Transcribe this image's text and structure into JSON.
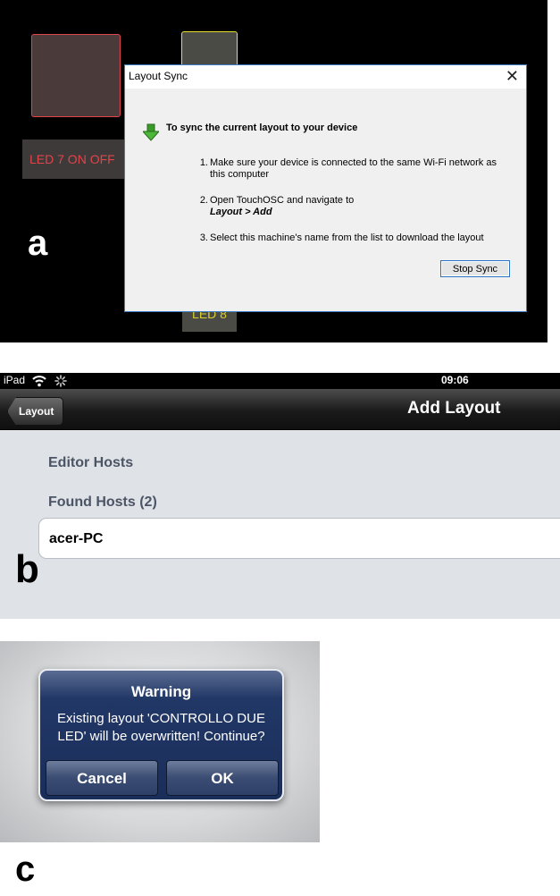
{
  "panel_a": {
    "letter": "a",
    "led_label": "LED 7 ON OFF",
    "led_bottom_label": "LED 8",
    "dialog": {
      "title": "Layout Sync",
      "close_glyph": "✕",
      "heading": "To sync the current layout to your device",
      "steps": [
        {
          "num": "1.",
          "text_line1": "Make sure your device is connected to the same Wi-Fi network as",
          "text_line2": "this computer"
        },
        {
          "num": "2.",
          "text_line1": "Open TouchOSC and navigate to",
          "text_line2": "Layout > Add"
        },
        {
          "num": "3.",
          "text_line1": "Select this machine's name from the list to download the layout"
        }
      ],
      "stop_button": "Stop Sync",
      "icon": "green-down-arrow-icon"
    },
    "colors": {
      "red_led": "#e0454a",
      "yellow_led": "#e8e030"
    }
  },
  "panel_b": {
    "letter": "b",
    "status": {
      "carrier": "iPad",
      "time": "09:06"
    },
    "nav": {
      "back_label": "Layout",
      "title": "Add Layout"
    },
    "sections": {
      "editor_hosts": "Editor Hosts",
      "found_hosts": "Found Hosts (2)"
    },
    "hosts": [
      {
        "name": "acer-PC"
      }
    ]
  },
  "panel_c": {
    "letter": "c",
    "alert": {
      "title": "Warning",
      "message_line1": "Existing layout 'CONTROLLO DUE",
      "message_line2": "LED' will be overwritten! Continue?",
      "cancel": "Cancel",
      "ok": "OK"
    }
  }
}
